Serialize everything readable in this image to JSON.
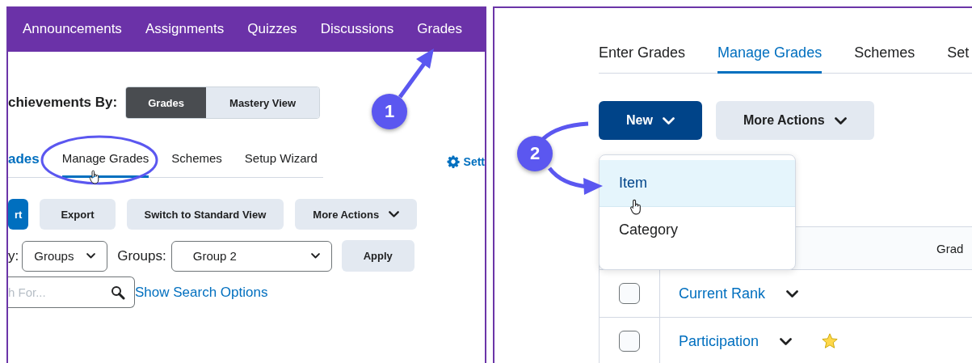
{
  "left_panel": {
    "nav_tabs": [
      {
        "label": "Announcements"
      },
      {
        "label": "Assignments"
      },
      {
        "label": "Quizzes"
      },
      {
        "label": "Discussions"
      },
      {
        "label": "Grades"
      }
    ],
    "view_toggle": {
      "label": "chievements By:",
      "options": [
        {
          "label": "Grades",
          "selected": true
        },
        {
          "label": "Mastery View",
          "selected": false
        }
      ]
    },
    "tabs_link": "ades",
    "tabs": [
      {
        "label": "Manage Grades",
        "selected": true
      },
      {
        "label": "Schemes",
        "selected": false
      },
      {
        "label": "Setup Wizard",
        "selected": false
      }
    ],
    "settings_link": "Sett",
    "buttons": [
      {
        "label": "rt",
        "kind": "primary"
      },
      {
        "label": "Export",
        "kind": "secondary"
      },
      {
        "label": "Switch to Standard View",
        "kind": "secondary"
      },
      {
        "label": "More Actions",
        "kind": "menu"
      }
    ],
    "filter": {
      "label": "y:",
      "view_select": "Groups",
      "groups_label": "Groups:",
      "groups_select": "Group 2",
      "apply": "Apply"
    },
    "search": {
      "placeholder": "h For...",
      "options_link": "Show Search Options"
    }
  },
  "right_panel": {
    "tabs": [
      {
        "label": "Enter Grades",
        "selected": false
      },
      {
        "label": "Manage Grades",
        "selected": true
      },
      {
        "label": "Schemes",
        "selected": false
      },
      {
        "label": "Set",
        "selected": false
      }
    ],
    "buttons": [
      {
        "label": "New",
        "kind": "primary"
      },
      {
        "label": "More Actions",
        "kind": "menu"
      }
    ],
    "menu": [
      {
        "label": "Item",
        "selected": true
      },
      {
        "label": "Category",
        "selected": false
      }
    ],
    "table": {
      "column_2": "Grad",
      "rows": [
        {
          "name": "Current Rank",
          "checked": false,
          "starred": false
        },
        {
          "name": "Participation",
          "checked": false,
          "starred": true
        }
      ]
    }
  },
  "annotations": [
    {
      "number": "1"
    },
    {
      "number": "2"
    }
  ]
}
